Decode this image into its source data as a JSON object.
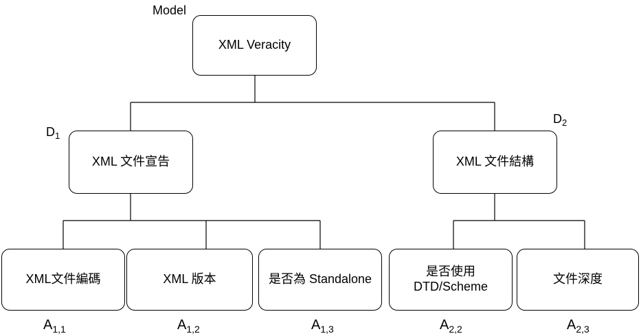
{
  "model_label": "Model",
  "root": {
    "text": "XML Veracity"
  },
  "dimensions": [
    {
      "tag_main": "D",
      "tag_sub": "1",
      "text": "XML 文件宣告"
    },
    {
      "tag_main": "D",
      "tag_sub": "2",
      "text": "XML 文件結構"
    }
  ],
  "attributes": [
    {
      "text": "XML文件編碼",
      "tag_main": "A",
      "tag_sub": "1,1"
    },
    {
      "text": "XML 版本",
      "tag_main": "A",
      "tag_sub": "1,2"
    },
    {
      "text": "是否為 Standalone",
      "tag_main": "A",
      "tag_sub": "1,3"
    },
    {
      "text_line1": "是否使用",
      "text_line2": "DTD/Scheme",
      "tag_main": "A",
      "tag_sub": "2,2"
    },
    {
      "text": "文件深度",
      "tag_main": "A",
      "tag_sub": "2,3"
    }
  ]
}
